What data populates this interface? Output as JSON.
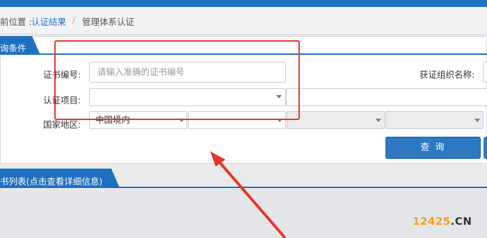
{
  "breadcrumb": {
    "position_label": "前位置 :",
    "link": "认证结果",
    "separator": "/",
    "current": "管理体系认证"
  },
  "query_section": {
    "tab_label": "询条件",
    "cert_no": {
      "label": "证书编号:",
      "placeholder": "请输入准确的证书编号"
    },
    "org_name": {
      "label": "获证组织名称:"
    },
    "project": {
      "label": "认证项目:",
      "value": ""
    },
    "region": {
      "label": "国家地区:",
      "country_value": "中国境内"
    },
    "query_button": "查 询"
  },
  "list_section": {
    "tab_label": "书列表(点击查看详细信息)"
  },
  "watermark": {
    "number": "12425",
    "domain": ".CN"
  },
  "colors": {
    "brand_blue": "#1a74c6",
    "button_blue": "#2e78c2",
    "annotation_red": "#e8332a",
    "watermark_orange": "#f2a11c"
  }
}
